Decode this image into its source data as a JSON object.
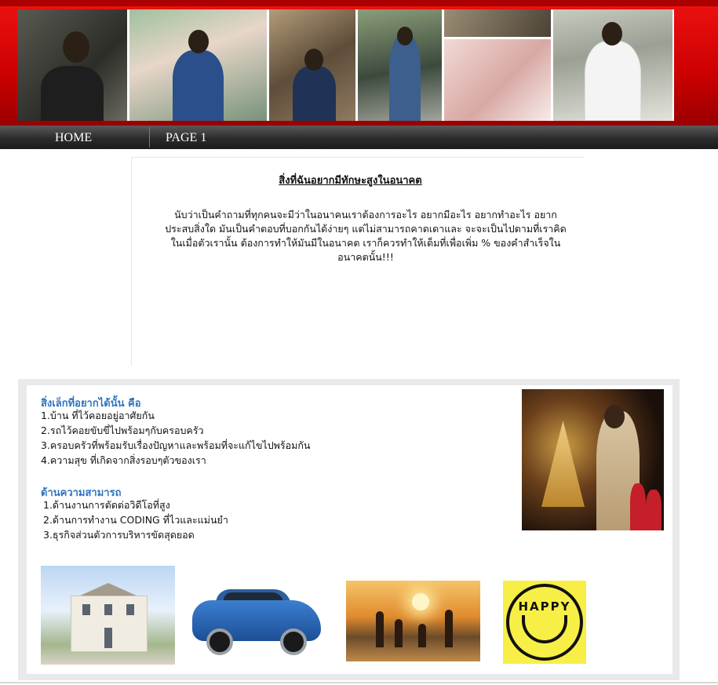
{
  "banner": {
    "photos": [
      "photo-1",
      "photo-2",
      "photo-3",
      "photo-4",
      "photo-5",
      "photo-6"
    ]
  },
  "nav": {
    "items": [
      {
        "label": "HOME"
      },
      {
        "label": "PAGE 1"
      }
    ]
  },
  "intro": {
    "title": "สิ่งที่ฉันอยากมีทักษะสูงในอนาคต",
    "body": "นับว่าเป็นคำถามที่ทุกคนจะมีว่าในอนาคนเราต้องการอะไร อยากมีอะไร อยากทำอะไร อยากประสบสิ่งใด  มันเป็นคำตอบที่บอกกันได้ง่ายๆ แต่ไม่สามารถคาดเดาและ จะจะเป็นไปตามที่เราคิด ในเมื่อตัวเรานั้น ต้องการทำให้มันมีในอนาคต เราก็ควรทำให้เต็มที่เพื่อเพิ่ม % ของคำสำเร็จในอนาคตนั้น!!!"
  },
  "wishes": {
    "title": "สิ่งเล็กที่อยากได้นั้น คือ",
    "items": [
      "1.บ้าน ที่ไว้คอยอยู่อาศัยกัน",
      "2.รถไว้คอยขับขี่ไปพร้อมๆกับครอบครัว",
      "3.ครอบครัวที่พร้อมรับเรื่องปัญหาและพร้อมที่จะแก้ไขไปพร้อมกัน",
      "4.ความสุข ที่เกิดจากสิ่งรอบๆตัวของเรา"
    ]
  },
  "skills": {
    "title": "ด้านความสามารถ",
    "items": [
      "1.ด้านงานการตัดต่อวิดีโอที่สูง",
      "2.ด้านการทำงาน CODING ที่ไวและแม่นยำ",
      "3.ธุรกิจส่วนตัวการบริหารขัดสุดยอด"
    ]
  },
  "happy_sign": "HAPPY",
  "colors": {
    "banner_red": "#cc0000",
    "nav_dark": "#2b2b2b",
    "section_title_blue": "#2e74c0",
    "happy_yellow": "#f7ef45"
  }
}
